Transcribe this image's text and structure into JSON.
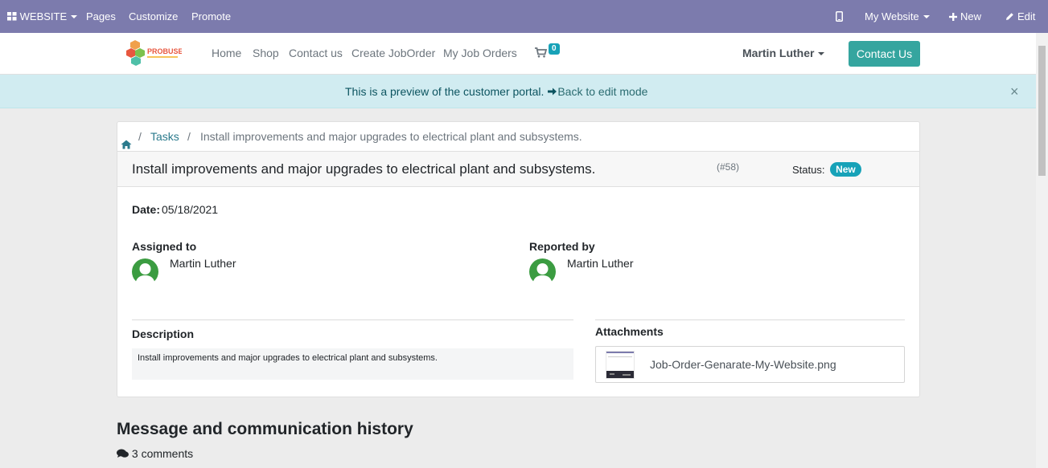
{
  "adminbar": {
    "website_label": "WEBSITE",
    "pages_label": "Pages",
    "customize_label": "Customize",
    "promote_label": "Promote",
    "my_website_label": "My Website",
    "new_label": "New",
    "edit_label": "Edit"
  },
  "header": {
    "logo_text": "PROBUSE",
    "nav": [
      "Home",
      "Shop",
      "Contact us",
      "Create JobOrder",
      "My Job Orders"
    ],
    "cart_count": "0",
    "user_name": "Martin Luther",
    "contact_button": "Contact Us"
  },
  "preview": {
    "message": "This is a preview of the customer portal.",
    "back_link": "Back to edit mode",
    "close": "×"
  },
  "breadcrumb": {
    "sep": "/",
    "tasks": "Tasks",
    "current": "Install improvements and major upgrades to electrical plant and subsystems."
  },
  "task": {
    "title": "Install improvements and major upgrades to electrical plant and subsystems.",
    "id": "(#58)",
    "status_label": "Status:",
    "status_value": "New",
    "date_label": "Date:",
    "date_value": "05/18/2021",
    "assigned_label": "Assigned to",
    "assigned_name": "Martin Luther",
    "reported_label": "Reported by",
    "reported_name": "Martin Luther",
    "description_label": "Description",
    "description_text": "Install improvements and major upgrades to electrical plant and subsystems.",
    "attachments_label": "Attachments",
    "attachment_name": "Job-Order-Genarate-My-Website.png"
  },
  "history": {
    "title": "Message and communication history",
    "comments": "3 comments"
  },
  "colors": {
    "admin_bar": "#7c7bad",
    "accent": "#35a59f",
    "badge": "#17a2b8",
    "preview_bg": "#d1ecf1"
  }
}
